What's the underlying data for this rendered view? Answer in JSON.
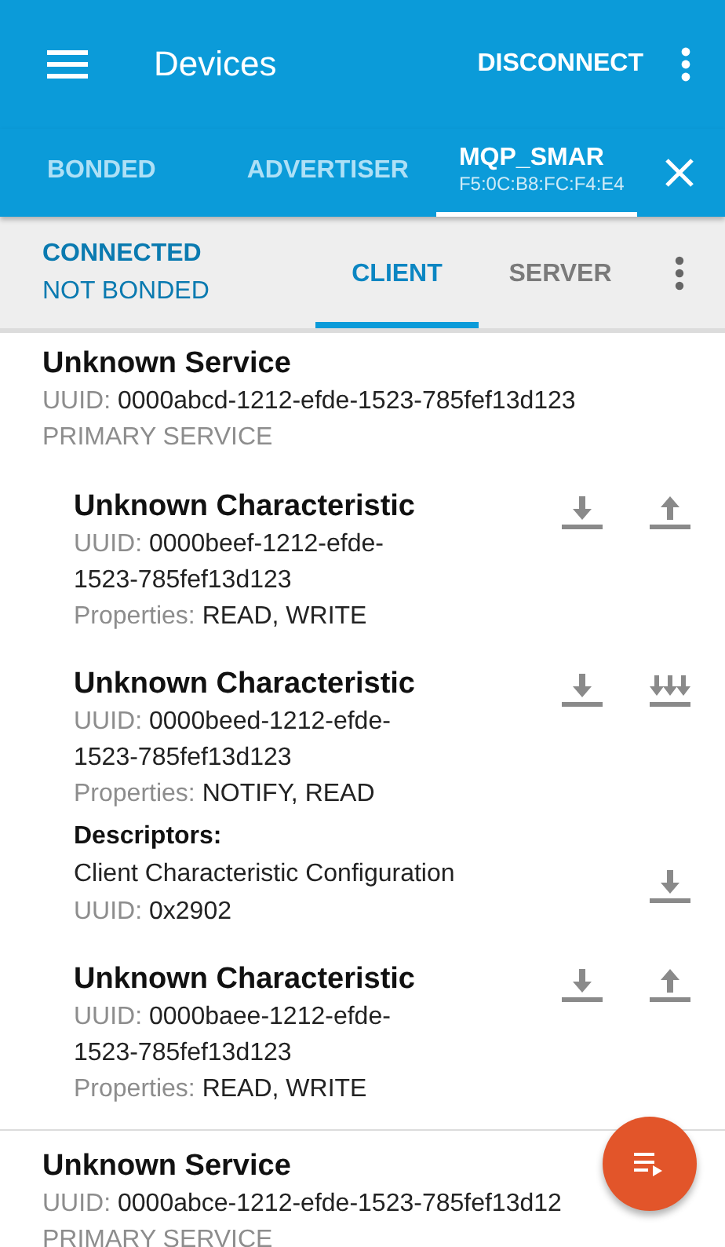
{
  "app_bar": {
    "title": "Devices",
    "action": "DISCONNECT"
  },
  "device_tabs": [
    {
      "label": "BONDED",
      "selected": false
    },
    {
      "label": "ADVERTISER",
      "selected": false
    },
    {
      "label": "MQP_SMAR",
      "subtitle": "F5:0C:B8:FC:F4:E4",
      "selected": true
    }
  ],
  "connection": {
    "state": "CONNECTED",
    "bond": "NOT BONDED"
  },
  "view_tabs": [
    {
      "label": "CLIENT",
      "selected": true
    },
    {
      "label": "SERVER",
      "selected": false
    }
  ],
  "services": [
    {
      "name": "Unknown Service",
      "uuid_label": "UUID:",
      "uuid": "0000abcd-1212-efde-1523-785fef13d123",
      "type": "PRIMARY SERVICE",
      "characteristics": [
        {
          "name": "Unknown Characteristic",
          "uuid_label": "UUID:",
          "uuid": "0000beef-1212-efde-1523-785fef13d123",
          "properties_label": "Properties:",
          "properties": "READ, WRITE",
          "actions": [
            {
              "kind": "read"
            },
            {
              "kind": "write"
            }
          ]
        },
        {
          "name": "Unknown Characteristic",
          "uuid_label": "UUID:",
          "uuid": "0000beed-1212-efde-1523-785fef13d123",
          "properties_label": "Properties:",
          "properties": "NOTIFY, READ",
          "actions": [
            {
              "kind": "read"
            },
            {
              "kind": "notify"
            }
          ],
          "descriptors_label": "Descriptors:",
          "descriptors": [
            {
              "name": "Client Characteristic Configuration",
              "uuid_label": "UUID:",
              "uuid": "0x2902",
              "actions": [
                {
                  "kind": "read"
                }
              ]
            }
          ]
        },
        {
          "name": "Unknown Characteristic",
          "uuid_label": "UUID:",
          "uuid": "0000baee-1212-efde-1523-785fef13d123",
          "properties_label": "Properties:",
          "properties": "READ, WRITE",
          "actions": [
            {
              "kind": "read"
            },
            {
              "kind": "write"
            }
          ]
        }
      ]
    },
    {
      "name": "Unknown Service",
      "uuid_label": "UUID:",
      "uuid": "0000abce-1212-efde-1523-785fef13d12",
      "type": "PRIMARY SERVICE"
    }
  ]
}
